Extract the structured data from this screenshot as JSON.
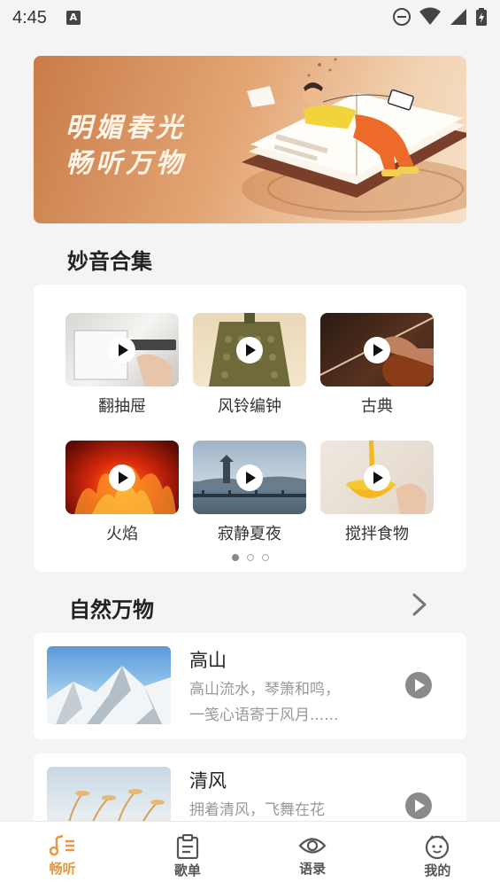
{
  "status": {
    "time": "4:45",
    "notification_badge": "A"
  },
  "banner": {
    "line1": "明媚春光",
    "line2": "畅听万物"
  },
  "collection": {
    "title": "妙音合集",
    "items": [
      {
        "label": "翻抽屉",
        "image": "drawer"
      },
      {
        "label": "风铃编钟",
        "image": "bronze-bell"
      },
      {
        "label": "古典",
        "image": "violin"
      },
      {
        "label": "火焰",
        "image": "fire"
      },
      {
        "label": "寂静夏夜",
        "image": "lake-pagoda"
      },
      {
        "label": "搅拌食物",
        "image": "mixing-egg"
      }
    ],
    "page_count": 3,
    "active_page": 1
  },
  "nature": {
    "title": "自然万物",
    "items": [
      {
        "title": "高山",
        "desc_line1": "高山流水，琴箫和鸣，",
        "desc_line2": "一笺心语寄于风月......",
        "image": "snow-mountain"
      },
      {
        "title": "清风",
        "desc_line1": "拥着清风，飞舞在花",
        "desc_line2": "",
        "image": "reed-grass"
      }
    ]
  },
  "tabbar": {
    "items": [
      {
        "label": "畅听",
        "icon": "music-list-icon",
        "active": true
      },
      {
        "label": "歌单",
        "icon": "clipboard-icon",
        "active": false
      },
      {
        "label": "语录",
        "icon": "eye-icon",
        "active": false
      },
      {
        "label": "我的",
        "icon": "face-icon",
        "active": false
      }
    ]
  },
  "colors": {
    "accent": "#e8963f",
    "background": "#f4f4f4"
  }
}
